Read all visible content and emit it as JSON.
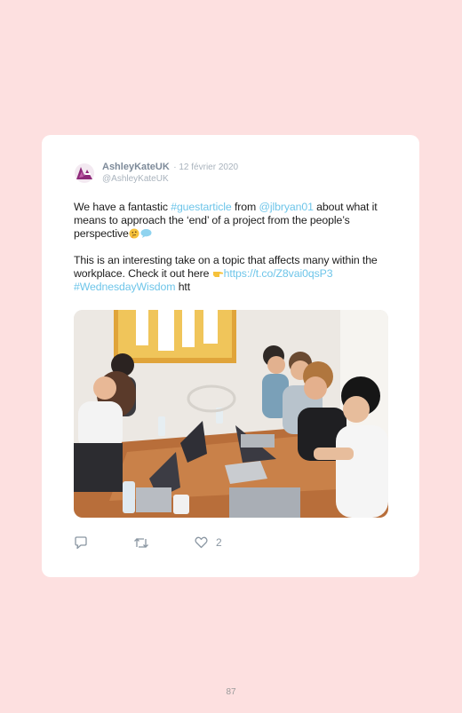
{
  "tweet": {
    "author_name": "AshleyKateUK",
    "date": "· 12 février 2020",
    "handle": "@AshleyKateUK",
    "text": {
      "p1_a": "We have a fantastic ",
      "p1_tag": "#guestarticle",
      "p1_b": " from ",
      "p1_mention": "@jlbryan01",
      "p1_c": " about what it means to approach the ‘end’ of a project from the people’s perspective",
      "p2_a": "This is an interesting take on a topic that affects many within the workplace. Check it out here ",
      "p2_link": "https://t.co/Z8vai0qsP3",
      "p2_tag": "#WednesdayWisdom",
      "p2_b": " htt"
    },
    "actions": {
      "reply_icon": "reply-icon",
      "retweet_icon": "retweet-icon",
      "like_icon": "heart-icon",
      "like_count": "2"
    },
    "emojis": [
      "thinking-face-emoji",
      "speech-bubble-emoji",
      "pointing-right-emoji"
    ]
  },
  "page": {
    "number": "87"
  },
  "colors": {
    "background": "#fde0e0",
    "link": "#6ec5e9",
    "avatar_brand": "#8e2a7a"
  }
}
